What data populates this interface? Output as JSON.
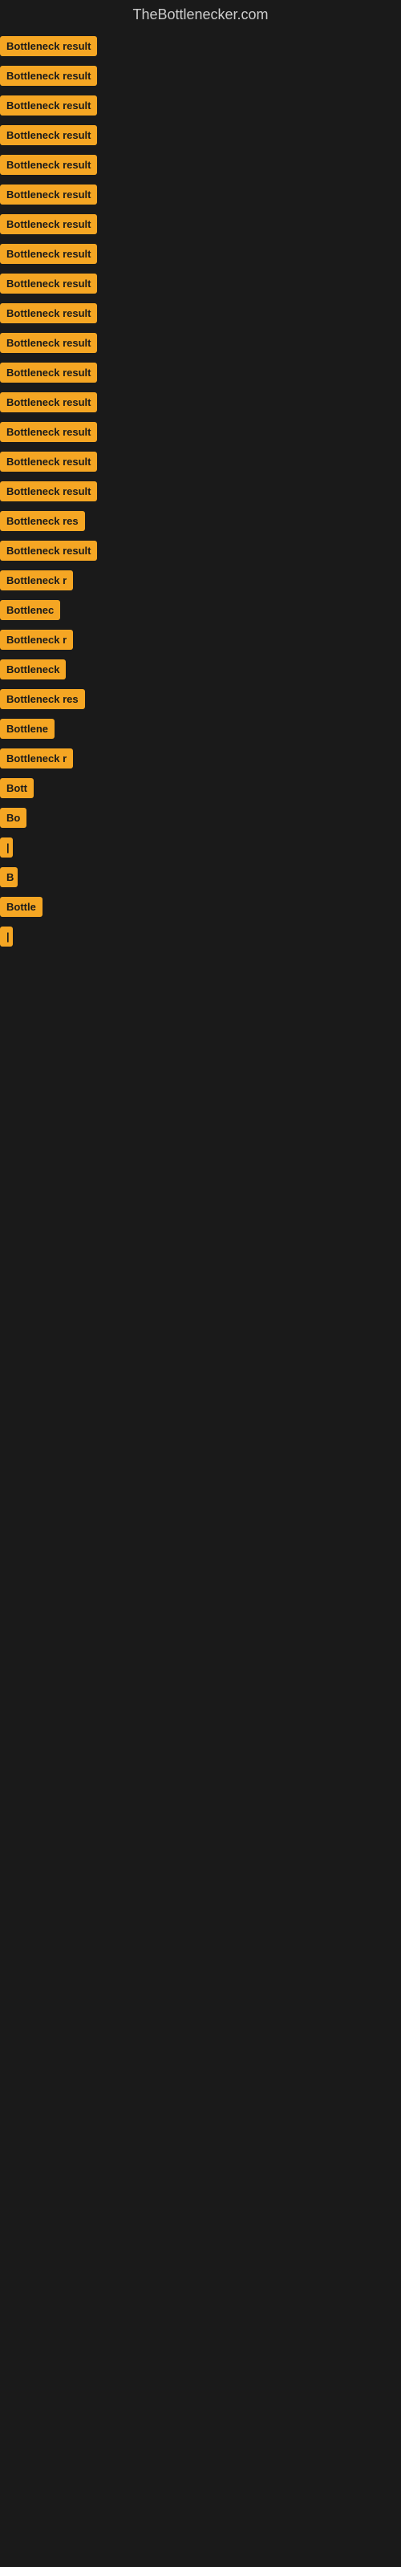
{
  "site": {
    "title": "TheBottlenecker.com"
  },
  "items": [
    {
      "label": "Bottleneck result",
      "width": 155
    },
    {
      "label": "Bottleneck result",
      "width": 155
    },
    {
      "label": "Bottleneck result",
      "width": 148
    },
    {
      "label": "Bottleneck result",
      "width": 148
    },
    {
      "label": "Bottleneck result",
      "width": 148
    },
    {
      "label": "Bottleneck result",
      "width": 148
    },
    {
      "label": "Bottleneck result",
      "width": 148
    },
    {
      "label": "Bottleneck result",
      "width": 148
    },
    {
      "label": "Bottleneck result",
      "width": 148
    },
    {
      "label": "Bottleneck result",
      "width": 148
    },
    {
      "label": "Bottleneck result",
      "width": 148
    },
    {
      "label": "Bottleneck result",
      "width": 148
    },
    {
      "label": "Bottleneck result",
      "width": 148
    },
    {
      "label": "Bottleneck result",
      "width": 148
    },
    {
      "label": "Bottleneck result",
      "width": 148
    },
    {
      "label": "Bottleneck result",
      "width": 148
    },
    {
      "label": "Bottleneck res",
      "width": 125
    },
    {
      "label": "Bottleneck result",
      "width": 140
    },
    {
      "label": "Bottleneck r",
      "width": 110
    },
    {
      "label": "Bottlenec",
      "width": 95
    },
    {
      "label": "Bottleneck r",
      "width": 110
    },
    {
      "label": "Bottleneck",
      "width": 100
    },
    {
      "label": "Bottleneck res",
      "width": 125
    },
    {
      "label": "Bottlene",
      "width": 88
    },
    {
      "label": "Bottleneck r",
      "width": 110
    },
    {
      "label": "Bott",
      "width": 55
    },
    {
      "label": "Bo",
      "width": 35
    },
    {
      "label": "|",
      "width": 12
    },
    {
      "label": "B",
      "width": 22
    },
    {
      "label": "Bottle",
      "width": 60
    },
    {
      "label": "|",
      "width": 12
    }
  ]
}
